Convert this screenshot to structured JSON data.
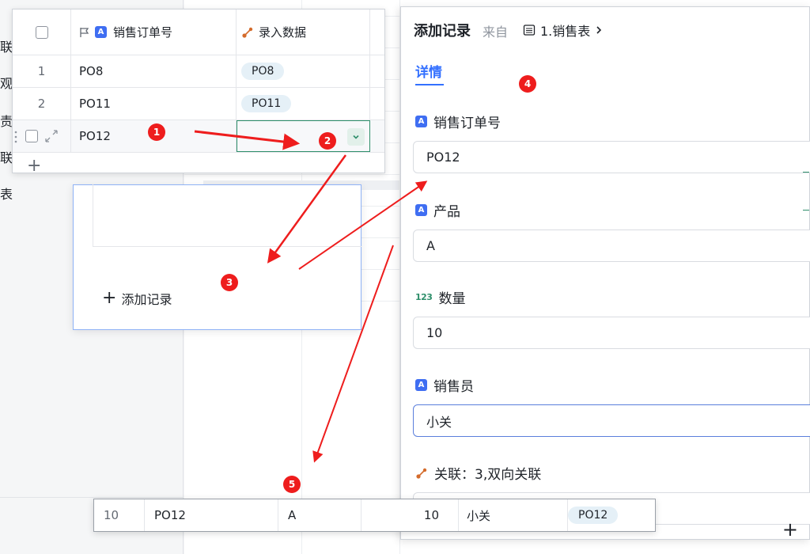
{
  "background": {
    "sidebar_fragments": [
      "联",
      "观",
      "责",
      "联",
      "表"
    ]
  },
  "table": {
    "header_field": "销售订单号",
    "header_link": "录入数据",
    "rows": [
      {
        "index": "1",
        "order": "PO8",
        "link": "PO8"
      },
      {
        "index": "2",
        "order": "PO11",
        "link": "PO11"
      },
      {
        "index": "",
        "order": "PO12",
        "link": ""
      }
    ]
  },
  "add_popover": {
    "add_label": "添加记录"
  },
  "panel": {
    "title": "添加记录",
    "from_label": "来自",
    "source_table": "1.销售表",
    "tab_detail": "详情",
    "fields": [
      {
        "label": "销售订单号",
        "value": "PO12",
        "type": "text"
      },
      {
        "label": "产品",
        "value": "A",
        "type": "text"
      },
      {
        "label": "数量",
        "value": "10",
        "type": "number",
        "icon_text": "123"
      },
      {
        "label": "销售员",
        "value": "小关",
        "type": "text"
      },
      {
        "label": "关联：3,双向关联",
        "value": "",
        "type": "link"
      }
    ]
  },
  "result_row": {
    "index": "10",
    "order": "PO12",
    "product": "A",
    "quantity": "10",
    "salesperson": "小关",
    "link": "PO12"
  },
  "annotations": [
    "1",
    "2",
    "3",
    "4",
    "5"
  ],
  "colors": {
    "accent": "#3370ff",
    "annotation": "#ee1d1d",
    "active_cell": "#2f8f6b",
    "chip": "#e5f0f7"
  }
}
